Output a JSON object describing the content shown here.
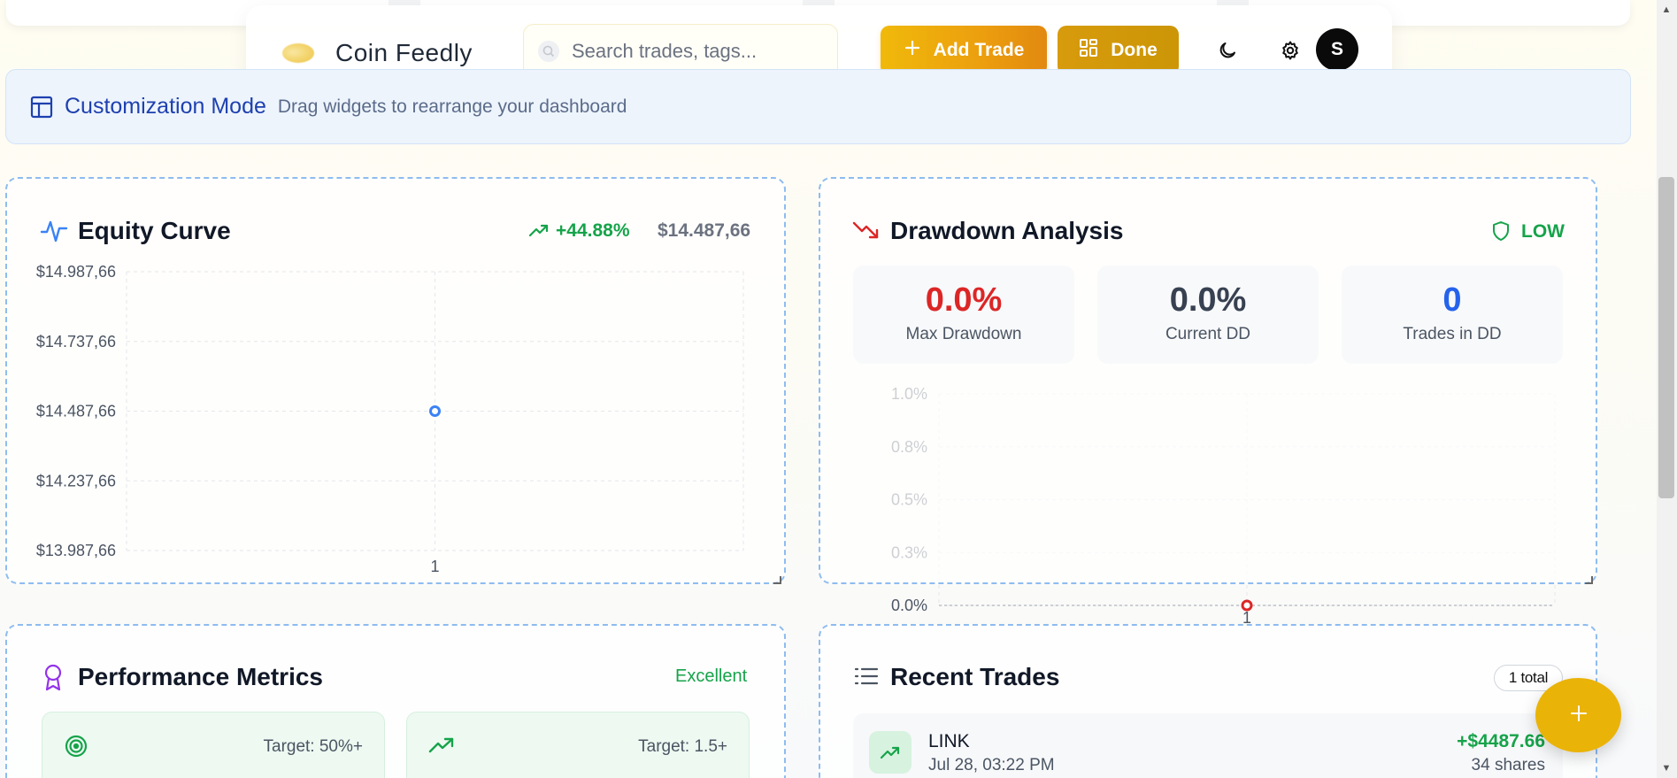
{
  "app": {
    "brand_part1": "Coin",
    "brand_part2": "Feedly",
    "logo_icon": "coin-blob-icon"
  },
  "header": {
    "search_placeholder": "Search trades, tags...",
    "add_trade_label": "Add Trade",
    "done_label": "Done",
    "avatar_initial": "S",
    "icons": [
      "search-icon",
      "plus-icon",
      "grid-layout-icon",
      "moon-icon",
      "gear-icon"
    ]
  },
  "banner": {
    "title": "Customization Mode",
    "description": "Drag widgets to rearrange your dashboard",
    "icon": "layout-icon"
  },
  "equity": {
    "title": "Equity Curve",
    "change": "+44.88%",
    "balance": "$14.487,66",
    "icon": "activity-icon"
  },
  "drawdown": {
    "title": "Drawdown Analysis",
    "risk": "LOW",
    "stats": [
      {
        "value": "0.0%",
        "label": "Max Drawdown"
      },
      {
        "value": "0.0%",
        "label": "Current DD"
      },
      {
        "value": "0",
        "label": "Trades in DD"
      }
    ],
    "icon": "trending-down-icon"
  },
  "performance": {
    "title": "Performance Metrics",
    "rating": "Excellent",
    "targets": [
      "Target: 50%+",
      "Target: 1.5+"
    ]
  },
  "recent_trades": {
    "title": "Recent Trades",
    "total": "1 total",
    "trades": [
      {
        "symbol": "LINK",
        "date": "Jul 28, 03:22 PM",
        "pnl": "+$4487.66",
        "shares": "34 shares"
      }
    ]
  },
  "colors": {
    "accent_gold": "#eab308",
    "profit_green": "#16a34a",
    "loss_red": "#dc2626",
    "info_blue": "#2563eb",
    "dashed_border": "#8ebcf0"
  },
  "chart_data": [
    {
      "type": "line",
      "x": [
        "1"
      ],
      "series": [
        {
          "values": [
            14487.66
          ]
        }
      ],
      "y_ticks": [
        "$14.987,66",
        "$14.737,66",
        "$14.487,66",
        "$14.237,66",
        "$13.987,66"
      ],
      "ylim": [
        13987.66,
        14987.66
      ],
      "grid": true
    },
    {
      "type": "line",
      "x": [
        "1"
      ],
      "series": [
        {
          "values": [
            0.0
          ]
        }
      ],
      "y_ticks": [
        "1.0%",
        "0.8%",
        "0.5%",
        "0.3%",
        "0.0%"
      ],
      "ylim": [
        0,
        1.0
      ],
      "grid": true
    }
  ]
}
